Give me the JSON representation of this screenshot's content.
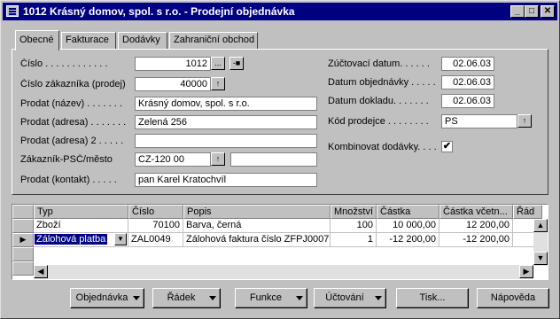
{
  "window": {
    "title": "1012 Krásný domov, spol. s r.o. - Prodejní objednávka"
  },
  "title_buttons": {
    "min": "_",
    "max": "□",
    "close": "✕"
  },
  "tabs": [
    "Obecné",
    "Fakturace",
    "Dodávky",
    "Zahraniční obchod"
  ],
  "form": {
    "cislo": {
      "label": "Číslo . . . . . . . . . . . .",
      "value": "1012",
      "lookup": "...",
      "assist": "-■"
    },
    "cislo_zakaznika": {
      "label": "Číslo zákazníka (prodej)",
      "value": "40000",
      "btn": "↑"
    },
    "prodat_nazev": {
      "label": "Prodat (název) . . . . . . .",
      "value": "Krásný domov, spol. s r.o."
    },
    "prodat_adresa": {
      "label": "Prodat (adresa) . . . . . . .",
      "value": "Zelená 256"
    },
    "prodat_adresa2": {
      "label": "Prodat (adresa) 2 . . . . .",
      "value": ""
    },
    "zakaznik_psc": {
      "label": "Zákazník-PSČ/město",
      "value": "CZ-120 00",
      "btn": "↑",
      "city": ""
    },
    "prodat_kontakt": {
      "label": "Prodat (kontakt) . . . . .",
      "value": "pan Karel Kratochvíl"
    },
    "zuctovaci_datum": {
      "label": "Zúčtovací datum. . . . . .",
      "value": "02.06.03"
    },
    "datum_objednavky": {
      "label": "Datum objednávky . . . . .",
      "value": "02.06.03"
    },
    "datum_dokladu": {
      "label": "Datum dokladu. . . . . . .",
      "value": "02.06.03"
    },
    "kod_prodejce": {
      "label": "Kód prodejce . . . . . . . .",
      "value": "PS",
      "btn": "↑"
    },
    "kombinovat": {
      "label": "Kombinovat dodávky. . . .",
      "checked": "✔"
    }
  },
  "grid": {
    "columns": [
      "Typ",
      "Číslo",
      "Popis",
      "Množství",
      "Částka",
      "Částka včetn...",
      "Řád"
    ],
    "rows": [
      {
        "typ": "Zboží",
        "cislo": "70100",
        "popis": "Barva, černá",
        "mnozstvi": "100",
        "castka": "10 000,00",
        "castka_vc": "12 200,00"
      },
      {
        "typ": "Zálohová platba",
        "cislo": "ZAL0049",
        "popis": "Zálohová faktura číslo ZFPJ0007",
        "mnozstvi": "1",
        "castka": "-12 200,00",
        "castka_vc": "-12 200,00"
      }
    ],
    "current_row_marker": "▶"
  },
  "buttons": {
    "objednavka": "Objednávka",
    "radek": "Řádek",
    "funkce": "Funkce",
    "uctovani": "Účtování",
    "tisk": "Tisk...",
    "napoveda": "Nápověda"
  },
  "icons": {
    "dropdown": "▼",
    "scroll_up": "▲",
    "scroll_down": "▼",
    "scroll_left": "◀",
    "scroll_right": "▶"
  }
}
